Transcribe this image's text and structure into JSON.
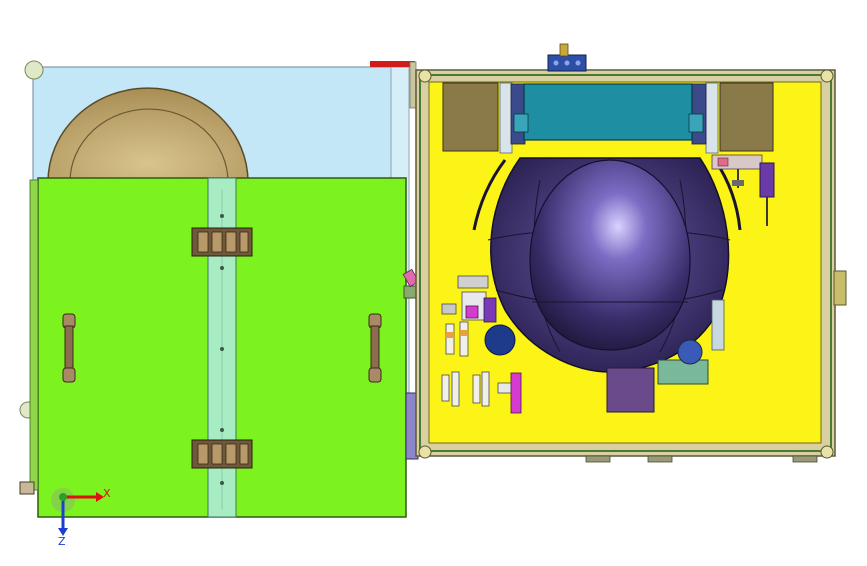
{
  "viewport": {
    "background": "#ffffff",
    "title": ""
  },
  "colors": {
    "lid_green": "#7cf21e",
    "panel_lightblue": "#c3e7f6",
    "base_yellow": "#fbf416",
    "hinge_strip": "#a8ecc4",
    "dome_purple": "#3b2f6e",
    "tank_tan": "#c8b27a",
    "frame_green": "#4a7a3a",
    "teal_block": "#1e8ea2",
    "brown_panel": "#8a7a4a"
  },
  "triad": {
    "x_label": "X",
    "z_label": "Z",
    "x_color": "#e01010",
    "z_color": "#1c3fd0",
    "y_color": "#2aa02a"
  },
  "icons": {
    "triad": "coordinate-triad-icon"
  }
}
